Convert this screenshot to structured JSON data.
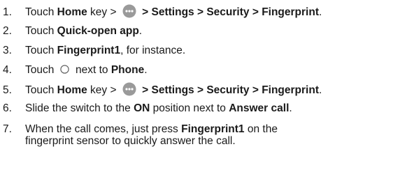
{
  "steps": [
    {
      "num": "1.",
      "t1": "Touch ",
      "home": "Home",
      "t2": " key > ",
      "icon": "apps-icon",
      "t3": " > ",
      "settings": "Settings",
      "sep1": " > ",
      "security": "Security",
      "sep2": " > ",
      "fingerprint": "Fingerprint",
      "end": "."
    },
    {
      "num": "2.",
      "t1": "Touch ",
      "bold": "Quick-open app",
      "end": "."
    },
    {
      "num": "3.",
      "t1": "Touch ",
      "bold": "Fingerprint1",
      "end": ", for instance."
    },
    {
      "num": "4.",
      "t1": "Touch ",
      "icon": "radio-button-icon",
      "t2": " next to ",
      "bold": "Phone",
      "end": "."
    },
    {
      "num": "5.",
      "t1": "Touch ",
      "home": "Home",
      "t2": " key > ",
      "icon": "apps-icon",
      "t3": " > ",
      "settings": "Settings",
      "sep1": " > ",
      "security": "Security",
      "sep2": " > ",
      "fingerprint": "Fingerprint",
      "end": "."
    },
    {
      "num": "6.",
      "t1": "Slide the switch to the ",
      "on": "ON",
      "t2": " position next to ",
      "answer": "Answer call",
      "end": "."
    },
    {
      "num": "7.",
      "t1": "When the call comes, just press ",
      "bold": "Fingerprint1",
      "t2": " on the fingerprint sensor to quickly answer the call."
    }
  ],
  "colors": {
    "text": "#1a1a1a",
    "icon_fill": "#9a9a9a"
  }
}
